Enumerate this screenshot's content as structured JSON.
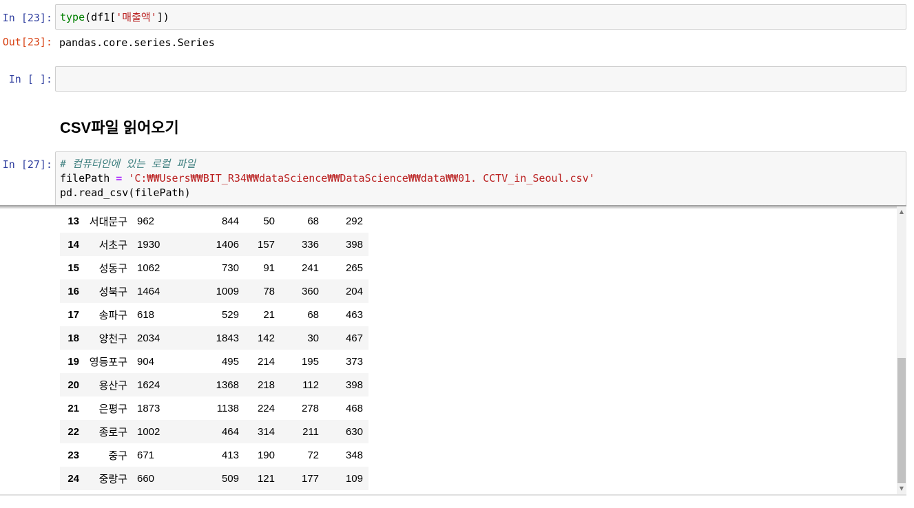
{
  "cells": {
    "c23": {
      "in_prompt": "In [23]:",
      "code": {
        "fn": "type",
        "mid": "(df1[",
        "str": "'매출액'",
        "end": "])"
      },
      "out_prompt": "Out[23]:",
      "output": "pandas.core.series.Series"
    },
    "empty": {
      "in_prompt": "In [ ]:"
    },
    "markdown": {
      "heading": "CSV파일 읽어오기"
    },
    "c27": {
      "in_prompt": "In [27]:",
      "comment": "# 컴퓨터안에 있는 로컬 파일",
      "line2_var": "filePath ",
      "line2_op": "=",
      "line2_str": " 'C:₩₩Users₩₩BIT_R34₩₩dataScience₩₩DataScience₩₩data₩₩01. CCTV_in_Seoul.csv'",
      "line3": "pd.read_csv(filePath)"
    }
  },
  "table": {
    "rows": [
      {
        "idx": "13",
        "name": "서대문구",
        "c1": "962",
        "c2": "844",
        "c3": "50",
        "c4": "68",
        "c5": "292"
      },
      {
        "idx": "14",
        "name": "서초구",
        "c1": "1930",
        "c2": "1406",
        "c3": "157",
        "c4": "336",
        "c5": "398"
      },
      {
        "idx": "15",
        "name": "성동구",
        "c1": "1062",
        "c2": "730",
        "c3": "91",
        "c4": "241",
        "c5": "265"
      },
      {
        "idx": "16",
        "name": "성북구",
        "c1": "1464",
        "c2": "1009",
        "c3": "78",
        "c4": "360",
        "c5": "204"
      },
      {
        "idx": "17",
        "name": "송파구",
        "c1": "618",
        "c2": "529",
        "c3": "21",
        "c4": "68",
        "c5": "463"
      },
      {
        "idx": "18",
        "name": "양천구",
        "c1": "2034",
        "c2": "1843",
        "c3": "142",
        "c4": "30",
        "c5": "467"
      },
      {
        "idx": "19",
        "name": "영등포구",
        "c1": "904",
        "c2": "495",
        "c3": "214",
        "c4": "195",
        "c5": "373"
      },
      {
        "idx": "20",
        "name": "용산구",
        "c1": "1624",
        "c2": "1368",
        "c3": "218",
        "c4": "112",
        "c5": "398"
      },
      {
        "idx": "21",
        "name": "은평구",
        "c1": "1873",
        "c2": "1138",
        "c3": "224",
        "c4": "278",
        "c5": "468"
      },
      {
        "idx": "22",
        "name": "종로구",
        "c1": "1002",
        "c2": "464",
        "c3": "314",
        "c4": "211",
        "c5": "630"
      },
      {
        "idx": "23",
        "name": "중구",
        "c1": "671",
        "c2": "413",
        "c3": "190",
        "c4": "72",
        "c5": "348"
      },
      {
        "idx": "24",
        "name": "중랑구",
        "c1": "660",
        "c2": "509",
        "c3": "121",
        "c4": "177",
        "c5": "109"
      }
    ]
  },
  "scrollbar": {
    "up_icon": "▲",
    "down_icon": "▼"
  }
}
